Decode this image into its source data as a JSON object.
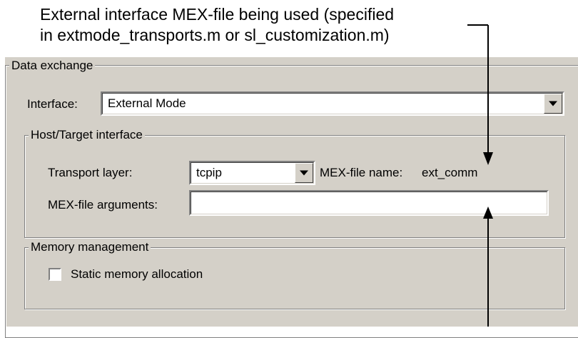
{
  "annotations": {
    "top_line1": "External interface MEX-file being used (specified",
    "top_line2": "in extmode_transports.m or sl_customization.m)"
  },
  "data_exchange": {
    "legend": "Data exchange",
    "interface_label": "Interface:",
    "interface_value": "External Mode",
    "host_target": {
      "legend": "Host/Target interface",
      "transport_label": "Transport layer:",
      "transport_value": "tcpip",
      "mex_name_label": "MEX-file name:",
      "mex_name_value": "ext_comm",
      "mex_args_label": "MEX-file arguments:",
      "mex_args_value": ""
    },
    "memory": {
      "legend": "Memory management",
      "static_alloc_label": "Static memory allocation",
      "static_alloc_checked": false
    }
  },
  "icons": {
    "dropdown": "chevron-down-icon",
    "arrow": "arrow-icon"
  },
  "colors": {
    "panel_bg": "#d4d0c8",
    "field_bg": "#ffffff",
    "shadow": "#808080"
  }
}
